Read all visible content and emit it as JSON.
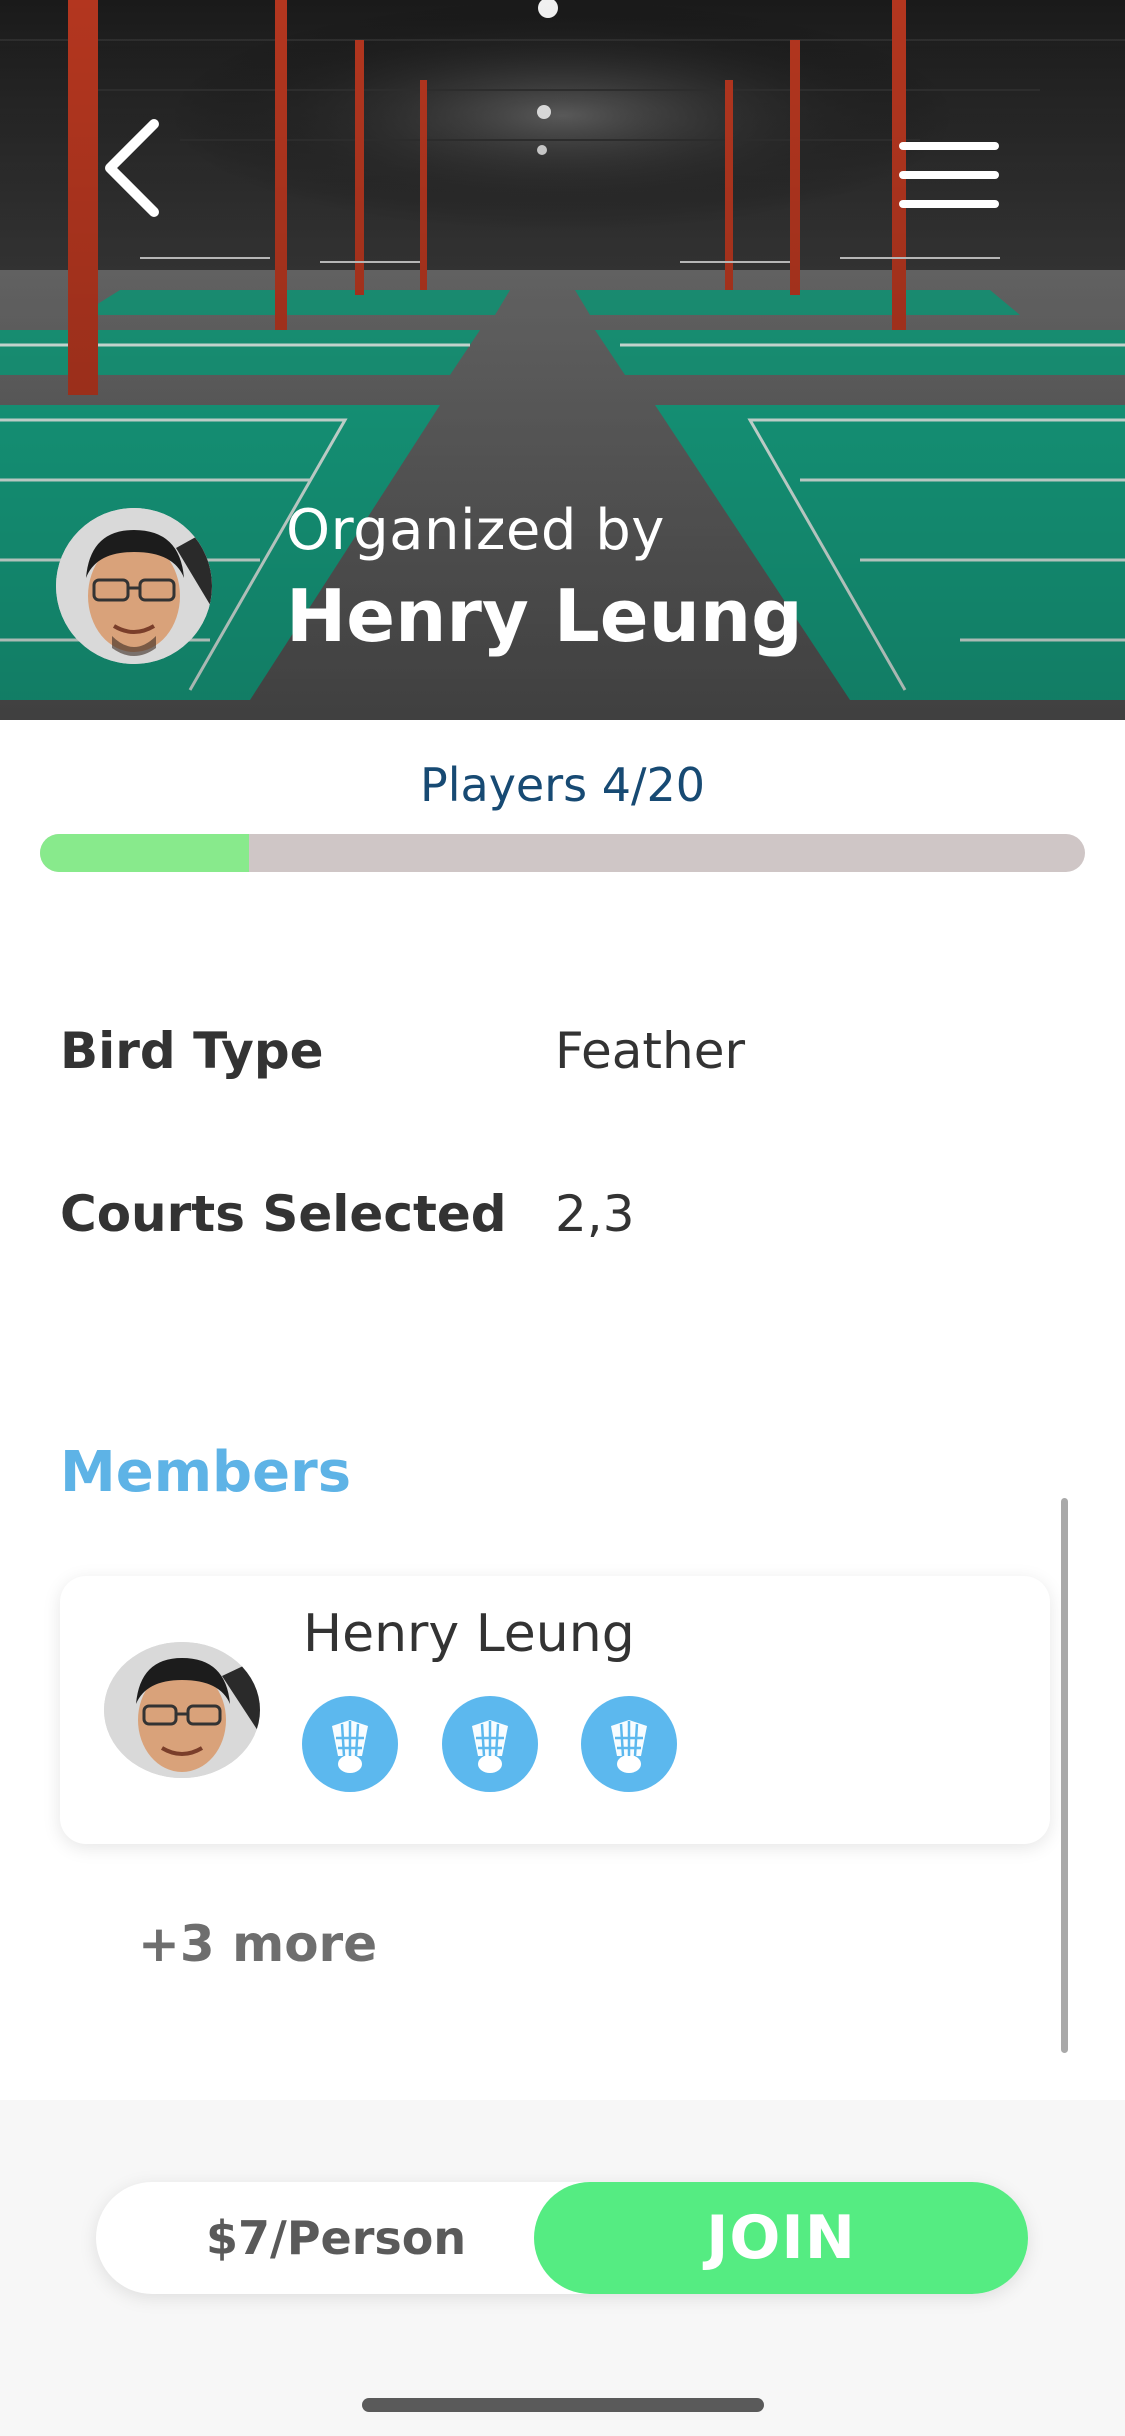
{
  "header": {
    "back_icon": "chevron-left-icon",
    "menu_icon": "hamburger-menu-icon",
    "organized_by_label": "Organized by",
    "organizer_name": "Henry Leung"
  },
  "players": {
    "label": "Players 4/20",
    "current": 4,
    "max": 20,
    "fill_fraction": 0.2,
    "fill_color": "#88ea8c",
    "track_color": "#cfc6c6"
  },
  "details": [
    {
      "label": "Bird Type",
      "value": "Feather"
    },
    {
      "label": "Courts Selected",
      "value": "2,3"
    }
  ],
  "members": {
    "title": "Members",
    "list": [
      {
        "name": "Henry Leung",
        "badges": [
          "shuttlecock-icon",
          "shuttlecock-icon",
          "shuttlecock-icon"
        ]
      }
    ],
    "more_label": "+3 more"
  },
  "footer": {
    "price_label": "$7/Person",
    "join_label": "JOIN",
    "join_color": "#55ec82"
  },
  "colors": {
    "accent_blue": "#5eb3e6",
    "court_green": "#17a585",
    "players_text": "#174a73"
  }
}
